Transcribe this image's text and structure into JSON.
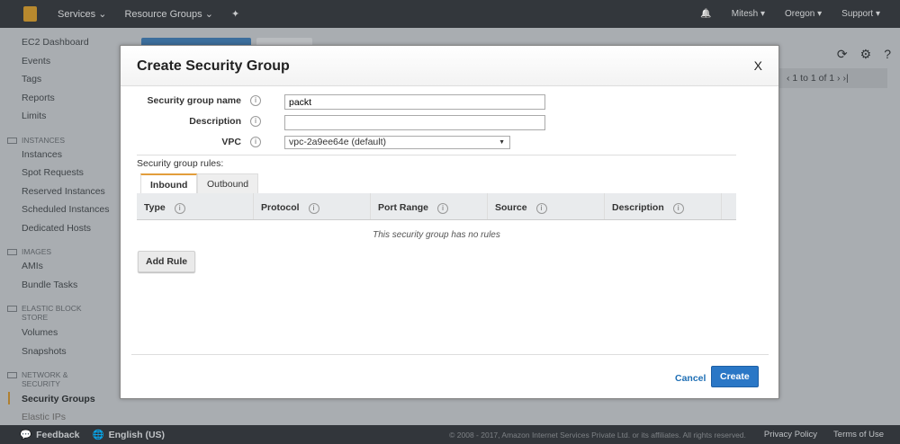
{
  "nav": {
    "services": "Services ⌄",
    "resource_groups": "Resource Groups ⌄",
    "pin": "✦",
    "bell": "🔔",
    "user": "Mitesh ▾",
    "region": "Oregon ▾",
    "support": "Support ▾"
  },
  "sidebar": {
    "items": [
      "EC2 Dashboard",
      "Events",
      "Tags",
      "Reports",
      "Limits"
    ],
    "instances_header": "INSTANCES",
    "instances": [
      "Instances",
      "Spot Requests",
      "Reserved Instances",
      "Scheduled Instances",
      "Dedicated Hosts"
    ],
    "images_header": "IMAGES",
    "images": [
      "AMIs",
      "Bundle Tasks"
    ],
    "ebs_header": "ELASTIC BLOCK STORE",
    "ebs": [
      "Volumes",
      "Snapshots"
    ],
    "net_header": "NETWORK & SECURITY",
    "net": [
      "Security Groups",
      "Elastic IPs"
    ]
  },
  "pager": "‹  1 to 1 of 1  ›  ›|",
  "modal": {
    "title": "Create Security Group",
    "close": "X",
    "fields": {
      "name_label": "Security group name",
      "name_value": "packt",
      "desc_label": "Description",
      "desc_value": "",
      "vpc_label": "VPC",
      "vpc_value": "vpc-2a9ee64e (default)"
    },
    "rules_label": "Security group rules:",
    "tabs": [
      "Inbound",
      "Outbound"
    ],
    "columns": [
      "Type",
      "Protocol",
      "Port Range",
      "Source",
      "Description"
    ],
    "empty": "This security group has no rules",
    "add_rule": "Add Rule",
    "cancel": "Cancel",
    "create": "Create"
  },
  "footer": {
    "feedback": "Feedback",
    "language": "English (US)",
    "copyright": "© 2008 - 2017, Amazon Internet Services Private Ltd. or its affiliates. All rights reserved.",
    "privacy": "Privacy Policy",
    "terms": "Terms of Use"
  }
}
